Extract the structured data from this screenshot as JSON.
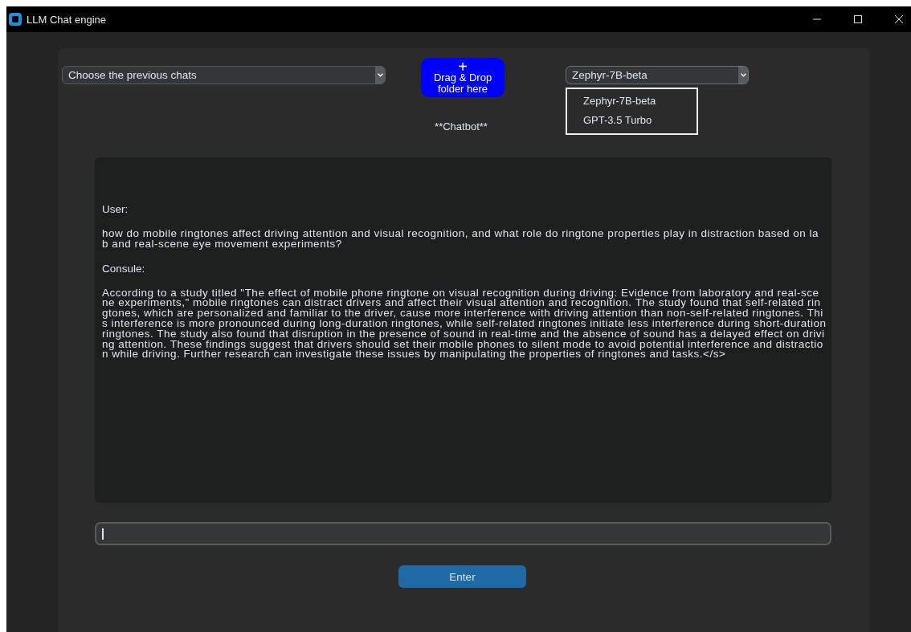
{
  "window": {
    "title": "LLM Chat engine"
  },
  "chat_selector": {
    "value": "Choose the previous chats"
  },
  "drop_zone": {
    "symbol": "+",
    "label": "Drag & Drop folder here"
  },
  "model_selector": {
    "value": "Zephyr-7B-beta",
    "expanded": true,
    "options": [
      "Zephyr-7B-beta",
      "GPT-3.5 Turbo"
    ]
  },
  "heading": "**Chatbot**",
  "conversation": [
    {
      "kind": "speaker",
      "text": "User:"
    },
    {
      "kind": "message",
      "lines": [
        "how do mobile ringtones affect driving attention and visual recognition, and what role do ringtone properties play in distraction based on la",
        "b and real-scene eye movement experiments?"
      ]
    },
    {
      "kind": "speaker",
      "text": "Consule:"
    },
    {
      "kind": "message",
      "lines": [
        "According to a study titled \"The effect of mobile phone ringtone on visual recognition during driving: Evidence from laboratory and real-sce",
        "ne experiments,\" mobile ringtones can distract drivers and affect their visual attention and recognition. The study found that self-related rin",
        "gtones, which are personalized and familiar to the driver, cause more interference with driving attention than non-self-related ringtones. Thi",
        "s interference is more pronounced during long-duration ringtones, while self-related ringtones initiate less interference during short-duration",
        "ringtones. The study also found that disruption in the presence of sound in real-time and the absence of sound has a delayed effect on drivi",
        "ng attention. These findings suggest that drivers should set their mobile phones to silent mode to avoid potential interference and distractio",
        "n while driving. Further research can investigate these issues by manipulating the properties of ringtones and tasks.</s>"
      ]
    }
  ],
  "input": {
    "focused": true
  },
  "enter_button": "Enter"
}
